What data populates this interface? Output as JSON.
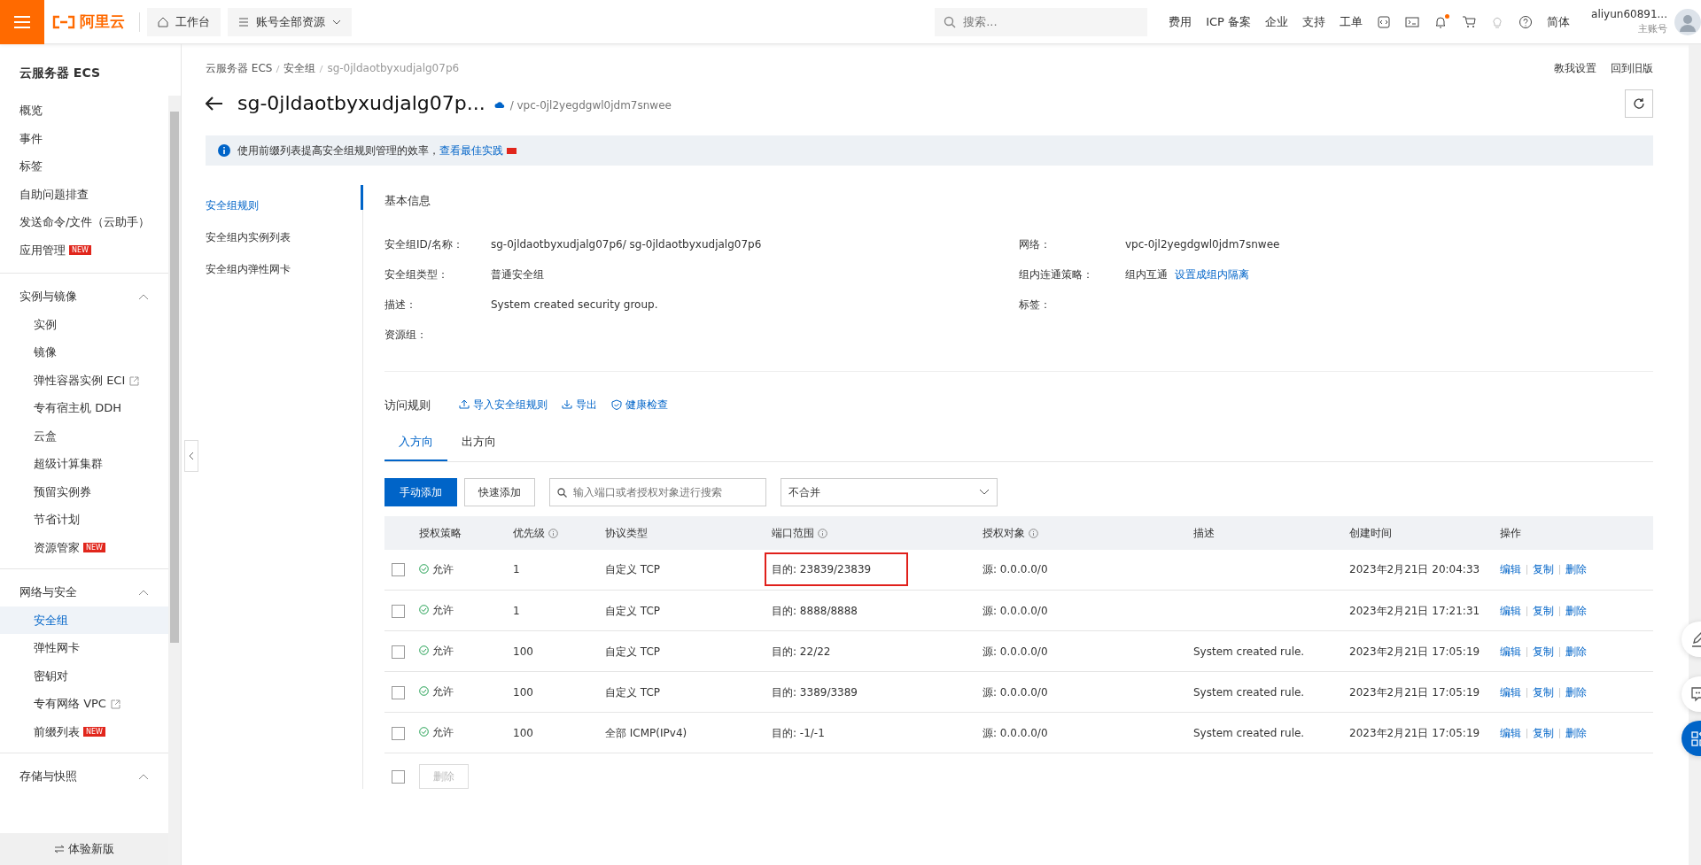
{
  "topbar": {
    "logo": "阿里云",
    "workbench": "工作台",
    "resources": "账号全部资源",
    "search_placeholder": "搜索...",
    "links": [
      "费用",
      "ICP 备案",
      "企业",
      "支持",
      "工单"
    ],
    "notification_dot": true,
    "language": "简体",
    "account": "aliyun60891...",
    "account_type": "主账号"
  },
  "sidebar": {
    "title": "云服务器 ECS",
    "footer": "体验新版",
    "sections": [
      {
        "items": [
          {
            "label": "概览",
            "selected": false
          },
          {
            "label": "事件",
            "selected": false
          },
          {
            "label": "标签",
            "selected": false
          },
          {
            "label": "自助问题排查",
            "selected": false
          },
          {
            "label": "发送命令/文件（云助手）",
            "selected": false
          },
          {
            "label": "应用管理",
            "badge": "NEW",
            "selected": false
          }
        ]
      },
      {
        "title": "实例与镜像",
        "expanded": true,
        "items": [
          {
            "label": "实例",
            "selected": false
          },
          {
            "label": "镜像",
            "selected": false
          },
          {
            "label": "弹性容器实例 ECI",
            "external": true,
            "selected": false
          },
          {
            "label": "专有宿主机 DDH",
            "selected": false
          },
          {
            "label": "云盒",
            "selected": false
          },
          {
            "label": "超级计算集群",
            "selected": false
          },
          {
            "label": "预留实例券",
            "selected": false
          },
          {
            "label": "节省计划",
            "selected": false
          },
          {
            "label": "资源管家",
            "badge": "NEW",
            "selected": false
          }
        ]
      },
      {
        "title": "网络与安全",
        "expanded": true,
        "items": [
          {
            "label": "安全组",
            "selected": true
          },
          {
            "label": "弹性网卡",
            "selected": false
          },
          {
            "label": "密钥对",
            "selected": false
          },
          {
            "label": "专有网络 VPC",
            "external": true,
            "selected": false
          },
          {
            "label": "前缀列表",
            "badge": "NEW",
            "selected": false
          }
        ]
      },
      {
        "title": "存储与快照",
        "expanded": true
      }
    ]
  },
  "breadcrumb": [
    "云服务器 ECS",
    "安全组",
    "sg-0jldaotbyxudjalg07p6"
  ],
  "header_links": [
    "教我设置",
    "回到旧版"
  ],
  "title": "sg-0jldaotbyxudjalg07p...",
  "vpc": "/ vpc-0jl2yegdgwl0jdm7snwee",
  "notice": {
    "text": "使用前缀列表提高安全组规则管理的效率，",
    "link": "查看最佳实践"
  },
  "subnav": [
    {
      "label": "安全组规则",
      "selected": true
    },
    {
      "label": "安全组内实例列表",
      "selected": false
    },
    {
      "label": "安全组内弹性网卡",
      "selected": false
    }
  ],
  "basic_info": {
    "title": "基本信息",
    "fields": [
      {
        "label": "安全组ID/名称：",
        "value": "sg-0jldaotbyxudjalg07p6/ sg-0jldaotbyxudjalg07p6"
      },
      {
        "label": "网络：",
        "value": "vpc-0jl2yegdgwl0jdm7snwee"
      },
      {
        "label": "安全组类型：",
        "value": "普通安全组"
      },
      {
        "label": "组内连通策略：",
        "value": "组内互通",
        "link": "设置成组内隔离"
      },
      {
        "label": "描述：",
        "value": "System created security group."
      },
      {
        "label": "标签："
      },
      {
        "label": "资源组："
      }
    ]
  },
  "rules": {
    "title": "访问规则",
    "actions": [
      "导入安全组规则",
      "导出",
      "健康检查"
    ],
    "tabs": [
      {
        "label": "入方向",
        "selected": true
      },
      {
        "label": "出方向",
        "selected": false
      }
    ],
    "add_button": "手动添加",
    "quick_add_button": "快速添加",
    "search_placeholder": "输入端口或者授权对象进行搜索",
    "merge_select": "不合并",
    "columns": [
      {
        "label": "授权策略",
        "info": false
      },
      {
        "label": "优先级",
        "info": true
      },
      {
        "label": "协议类型",
        "info": false
      },
      {
        "label": "端口范围",
        "info": true
      },
      {
        "label": "授权对象",
        "info": true
      },
      {
        "label": "描述",
        "info": false
      },
      {
        "label": "创建时间",
        "info": false
      },
      {
        "label": "操作",
        "info": false
      }
    ],
    "rows": [
      {
        "checked": false,
        "policy": "允许",
        "priority": "1",
        "protocol": "自定义 TCP",
        "port": "目的: 23839/23839",
        "highlighted": true,
        "source": "源: 0.0.0.0/0",
        "description": "",
        "created": "2023年2月21日 20:04:33",
        "actions": [
          "编辑",
          "复制",
          "删除"
        ]
      },
      {
        "checked": false,
        "policy": "允许",
        "priority": "1",
        "protocol": "自定义 TCP",
        "port": "目的: 8888/8888",
        "highlighted": false,
        "source": "源: 0.0.0.0/0",
        "description": "",
        "created": "2023年2月21日 17:21:31",
        "actions": [
          "编辑",
          "复制",
          "删除"
        ]
      },
      {
        "checked": false,
        "policy": "允许",
        "priority": "100",
        "protocol": "自定义 TCP",
        "port": "目的: 22/22",
        "highlighted": false,
        "source": "源: 0.0.0.0/0",
        "description": "System created rule.",
        "created": "2023年2月21日 17:05:19",
        "actions": [
          "编辑",
          "复制",
          "删除"
        ]
      },
      {
        "checked": false,
        "policy": "允许",
        "priority": "100",
        "protocol": "自定义 TCP",
        "port": "目的: 3389/3389",
        "highlighted": false,
        "source": "源: 0.0.0.0/0",
        "description": "System created rule.",
        "created": "2023年2月21日 17:05:19",
        "actions": [
          "编辑",
          "复制",
          "删除"
        ]
      },
      {
        "checked": false,
        "policy": "允许",
        "priority": "100",
        "protocol": "全部 ICMP(IPv4)",
        "port": "目的: -1/-1",
        "highlighted": false,
        "source": "源: 0.0.0.0/0",
        "description": "System created rule.",
        "created": "2023年2月21日 17:05:19",
        "actions": [
          "编辑",
          "复制",
          "删除"
        ]
      }
    ],
    "select_all_checked": false,
    "delete_button": "删除",
    "delete_disabled": true
  }
}
